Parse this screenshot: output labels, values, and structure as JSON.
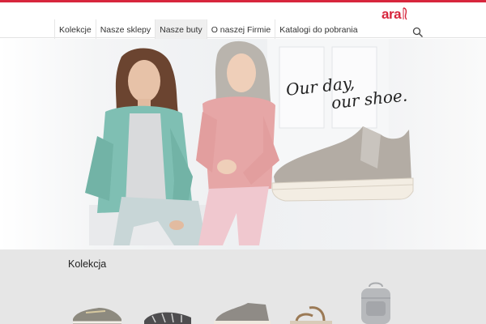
{
  "brand": {
    "name": "ara",
    "color": "#d7263d"
  },
  "nav": {
    "items": [
      {
        "label": "Kolekcje",
        "active": false
      },
      {
        "label": "Nasze sklepy",
        "active": false
      },
      {
        "label": "Nasze buty",
        "active": true
      },
      {
        "label": "O naszej Firmie",
        "active": false
      },
      {
        "label": "Katalogi do pobrania",
        "active": false
      }
    ],
    "search_icon": "search-icon"
  },
  "hero": {
    "slogan_line1": "Our day,",
    "slogan_line2": "our shoe."
  },
  "collection": {
    "title": "Kolekcja",
    "products": [
      "sneaker",
      "sandal",
      "ankle-boot",
      "sandal",
      "backpack"
    ]
  }
}
